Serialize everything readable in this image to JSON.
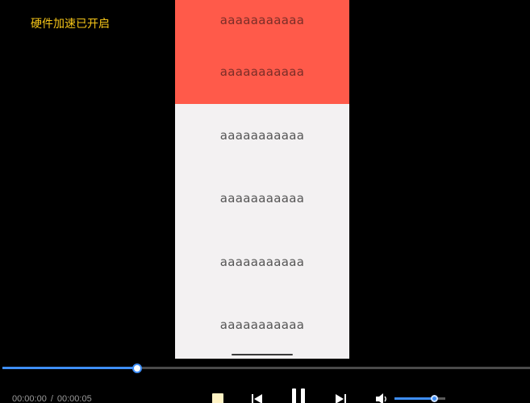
{
  "hardware_badge": "硬件加速已开启",
  "phone": {
    "rows": [
      {
        "text": "aaaaaaaaaaa",
        "highlight": true
      },
      {
        "text": "aaaaaaaaaaa",
        "highlight": true
      },
      {
        "text": "aaaaaaaaaaa",
        "highlight": false
      },
      {
        "text": "aaaaaaaaaaa",
        "highlight": false
      },
      {
        "text": "aaaaaaaaaaa",
        "highlight": false
      },
      {
        "text": "aaaaaaaaaaa",
        "highlight": false
      }
    ]
  },
  "player": {
    "current_time": "00:00:00",
    "separator": "/",
    "duration": "00:00:05",
    "progress_fraction": 0.255,
    "volume_fraction": 0.78
  },
  "colors": {
    "accent": "#3e8ef7",
    "badge": "#f5c518",
    "highlight_row": "#ff5a4a",
    "list_bg": "#f3f1f2"
  }
}
